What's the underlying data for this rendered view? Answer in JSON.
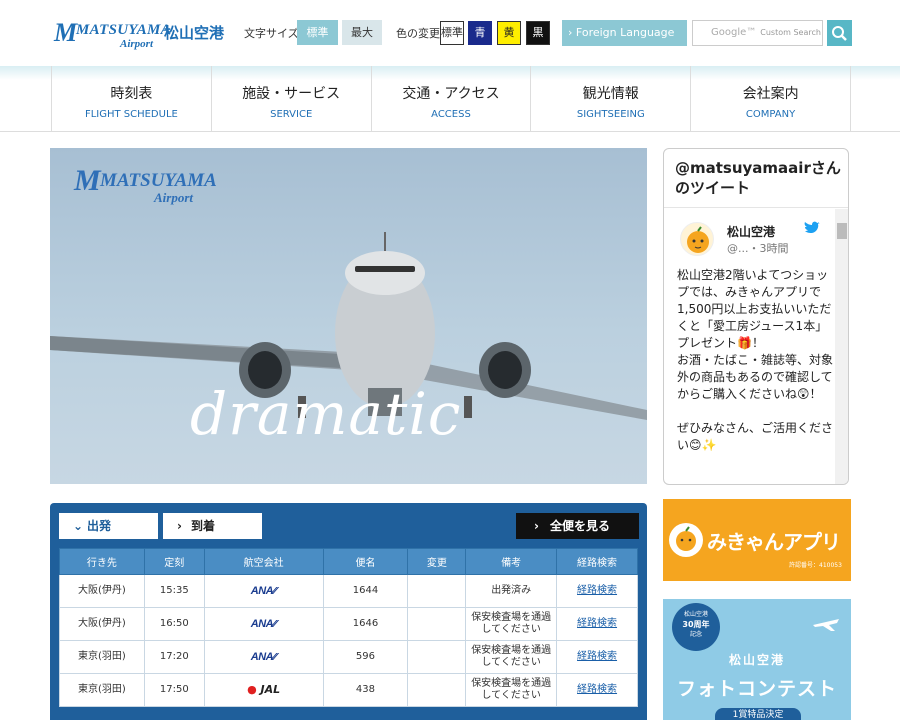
{
  "header": {
    "logo_wordmark": "MATSUYAMA",
    "logo_sub": "Airport",
    "logo_jp": "松山空港",
    "font_size_label": "文字サイズ",
    "font_size_options": [
      "標準",
      "最大"
    ],
    "color_label": "色の変更",
    "color_options": [
      "標準",
      "青",
      "黄",
      "黒"
    ],
    "foreign_language": "Foreign Language",
    "search_google": "Google™",
    "search_placeholder": "Custom Search"
  },
  "nav": [
    {
      "jp": "時刻表",
      "en": "FLIGHT SCHEDULE"
    },
    {
      "jp": "施設・サービス",
      "en": "SERVICE"
    },
    {
      "jp": "交通・アクセス",
      "en": "ACCESS"
    },
    {
      "jp": "観光情報",
      "en": "SIGHTSEEING"
    },
    {
      "jp": "会社案内",
      "en": "COMPANY"
    }
  ],
  "hero": {
    "logo_wordmark": "MATSUYAMA",
    "logo_sub": "Airport",
    "caption": "dramatic"
  },
  "twitter": {
    "title_line1": "@matsuyamaairさん",
    "title_line2": "のツイート",
    "account_name": "松山空港",
    "account_handle": "@...・3時間",
    "tweet_lines": [
      "松山空港2階いよてつショップでは、みきゃんアプリで1,500円以上お支払いいただくと「愛工房ジュース1本」プレゼント🎁！",
      "お酒・たばこ・雑誌等、対象外の商品もあるので確認してからご購入くださいね😲！",
      "",
      "ぜひみなさん、ご活用ください😊✨"
    ]
  },
  "banners": {
    "mikan_title": "みきゃんアプリ",
    "mikan_note": "許認番号：410053",
    "photo_badge_line1": "松山空港",
    "photo_badge_line2": "30周年",
    "photo_badge_line3": "記念",
    "photo_sub": "松山空港",
    "photo_main": "フォトコンテスト",
    "photo_tab": "1賞特品決定"
  },
  "flights": {
    "tab_departure": "出発",
    "tab_arrival": "到着",
    "all_flights": "全便を見る",
    "columns": [
      "行き先",
      "定刻",
      "航空会社",
      "便名",
      "変更",
      "備考",
      "経路検索"
    ],
    "rows": [
      {
        "dest": "大阪(伊丹)",
        "time": "15:35",
        "airline": "ANA",
        "flight": "1644",
        "change": "",
        "note": "出発済み",
        "route": "経路検索"
      },
      {
        "dest": "大阪(伊丹)",
        "time": "16:50",
        "airline": "ANA",
        "flight": "1646",
        "change": "",
        "note": "保安検査場を通過してください",
        "route": "経路検索"
      },
      {
        "dest": "東京(羽田)",
        "time": "17:20",
        "airline": "ANA",
        "flight": "596",
        "change": "",
        "note": "保安検査場を通過してください",
        "route": "経路検索"
      },
      {
        "dest": "東京(羽田)",
        "time": "17:50",
        "airline": "JAL",
        "flight": "438",
        "change": "",
        "note": "保安検査場を通過してください",
        "route": "経路検索"
      }
    ]
  },
  "colors": {
    "brand_blue": "#1f6fb5",
    "accent_teal": "#8cc8d4",
    "table_header": "#4a8dc4",
    "panel_blue": "#1f5f9b",
    "mikan_orange": "#f5a51f"
  }
}
